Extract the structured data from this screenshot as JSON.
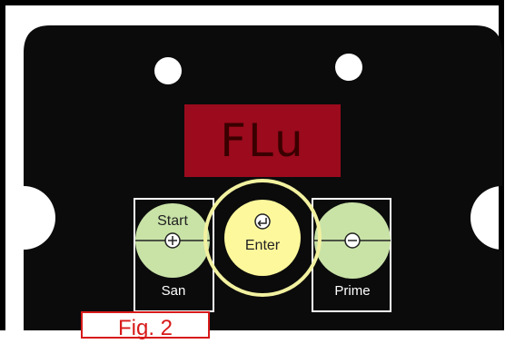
{
  "display": {
    "text": "FLu",
    "color": "#9b0a1d"
  },
  "keys": {
    "left": {
      "top_label": "Start",
      "bottom_label": "San",
      "symbol": "+"
    },
    "center": {
      "top_label": "Enter",
      "symbol": "↵"
    },
    "right": {
      "bottom_label": "Prime",
      "symbol": "−"
    }
  },
  "figure": {
    "label": "Fig. 2",
    "color": "#d81a1a"
  },
  "colors": {
    "panel": "#0b0b0b",
    "key_green": "#c9e3a7",
    "key_yellow": "#fef89c",
    "highlight": "#f2f1a0"
  }
}
